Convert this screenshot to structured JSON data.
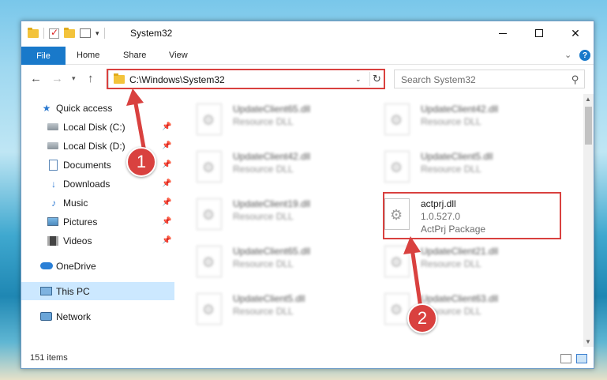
{
  "window": {
    "title": "System32",
    "minimize": "",
    "maximize": "",
    "close": "✕"
  },
  "ribbon": {
    "file": "File",
    "home": "Home",
    "share": "Share",
    "view": "View",
    "help": "?"
  },
  "navigation": {
    "address": "C:\\Windows\\System32",
    "search_placeholder": "Search System32"
  },
  "sidebar": {
    "items": [
      {
        "label": "Quick access"
      },
      {
        "label": "Local Disk (C:)"
      },
      {
        "label": "Local Disk (D:)"
      },
      {
        "label": "Documents"
      },
      {
        "label": "Downloads"
      },
      {
        "label": "Music"
      },
      {
        "label": "Pictures"
      },
      {
        "label": "Videos"
      },
      {
        "label": "OneDrive"
      },
      {
        "label": "This PC"
      },
      {
        "label": "Network"
      }
    ]
  },
  "files": [
    {
      "name": "UpdateClient65.dll",
      "type": "Resource DLL"
    },
    {
      "name": "UpdateClient42.dll",
      "type": "Resource DLL"
    },
    {
      "name": "UpdateClient42.dll",
      "type": "Resource DLL"
    },
    {
      "name": "UpdateClient5.dll",
      "type": "Resource DLL"
    },
    {
      "name": "UpdateClient19.dll",
      "type": "Resource DLL"
    },
    {
      "name": "actprj.dll",
      "version": "1.0.527.0",
      "type": "ActPrj Package"
    },
    {
      "name": "UpdateClient65.dll",
      "type": "Resource DLL"
    },
    {
      "name": "UpdateClient21.dll",
      "type": "Resource DLL"
    },
    {
      "name": "UpdateClient5.dll",
      "type": "Resource DLL"
    },
    {
      "name": "UpdateClient63.dll",
      "type": "Resource DLL"
    }
  ],
  "status": {
    "item_count": "151 items"
  },
  "callouts": {
    "one": "1",
    "two": "2"
  },
  "colors": {
    "accent": "#1979ca",
    "highlight": "#d9413f",
    "selected": "#cce8ff"
  }
}
